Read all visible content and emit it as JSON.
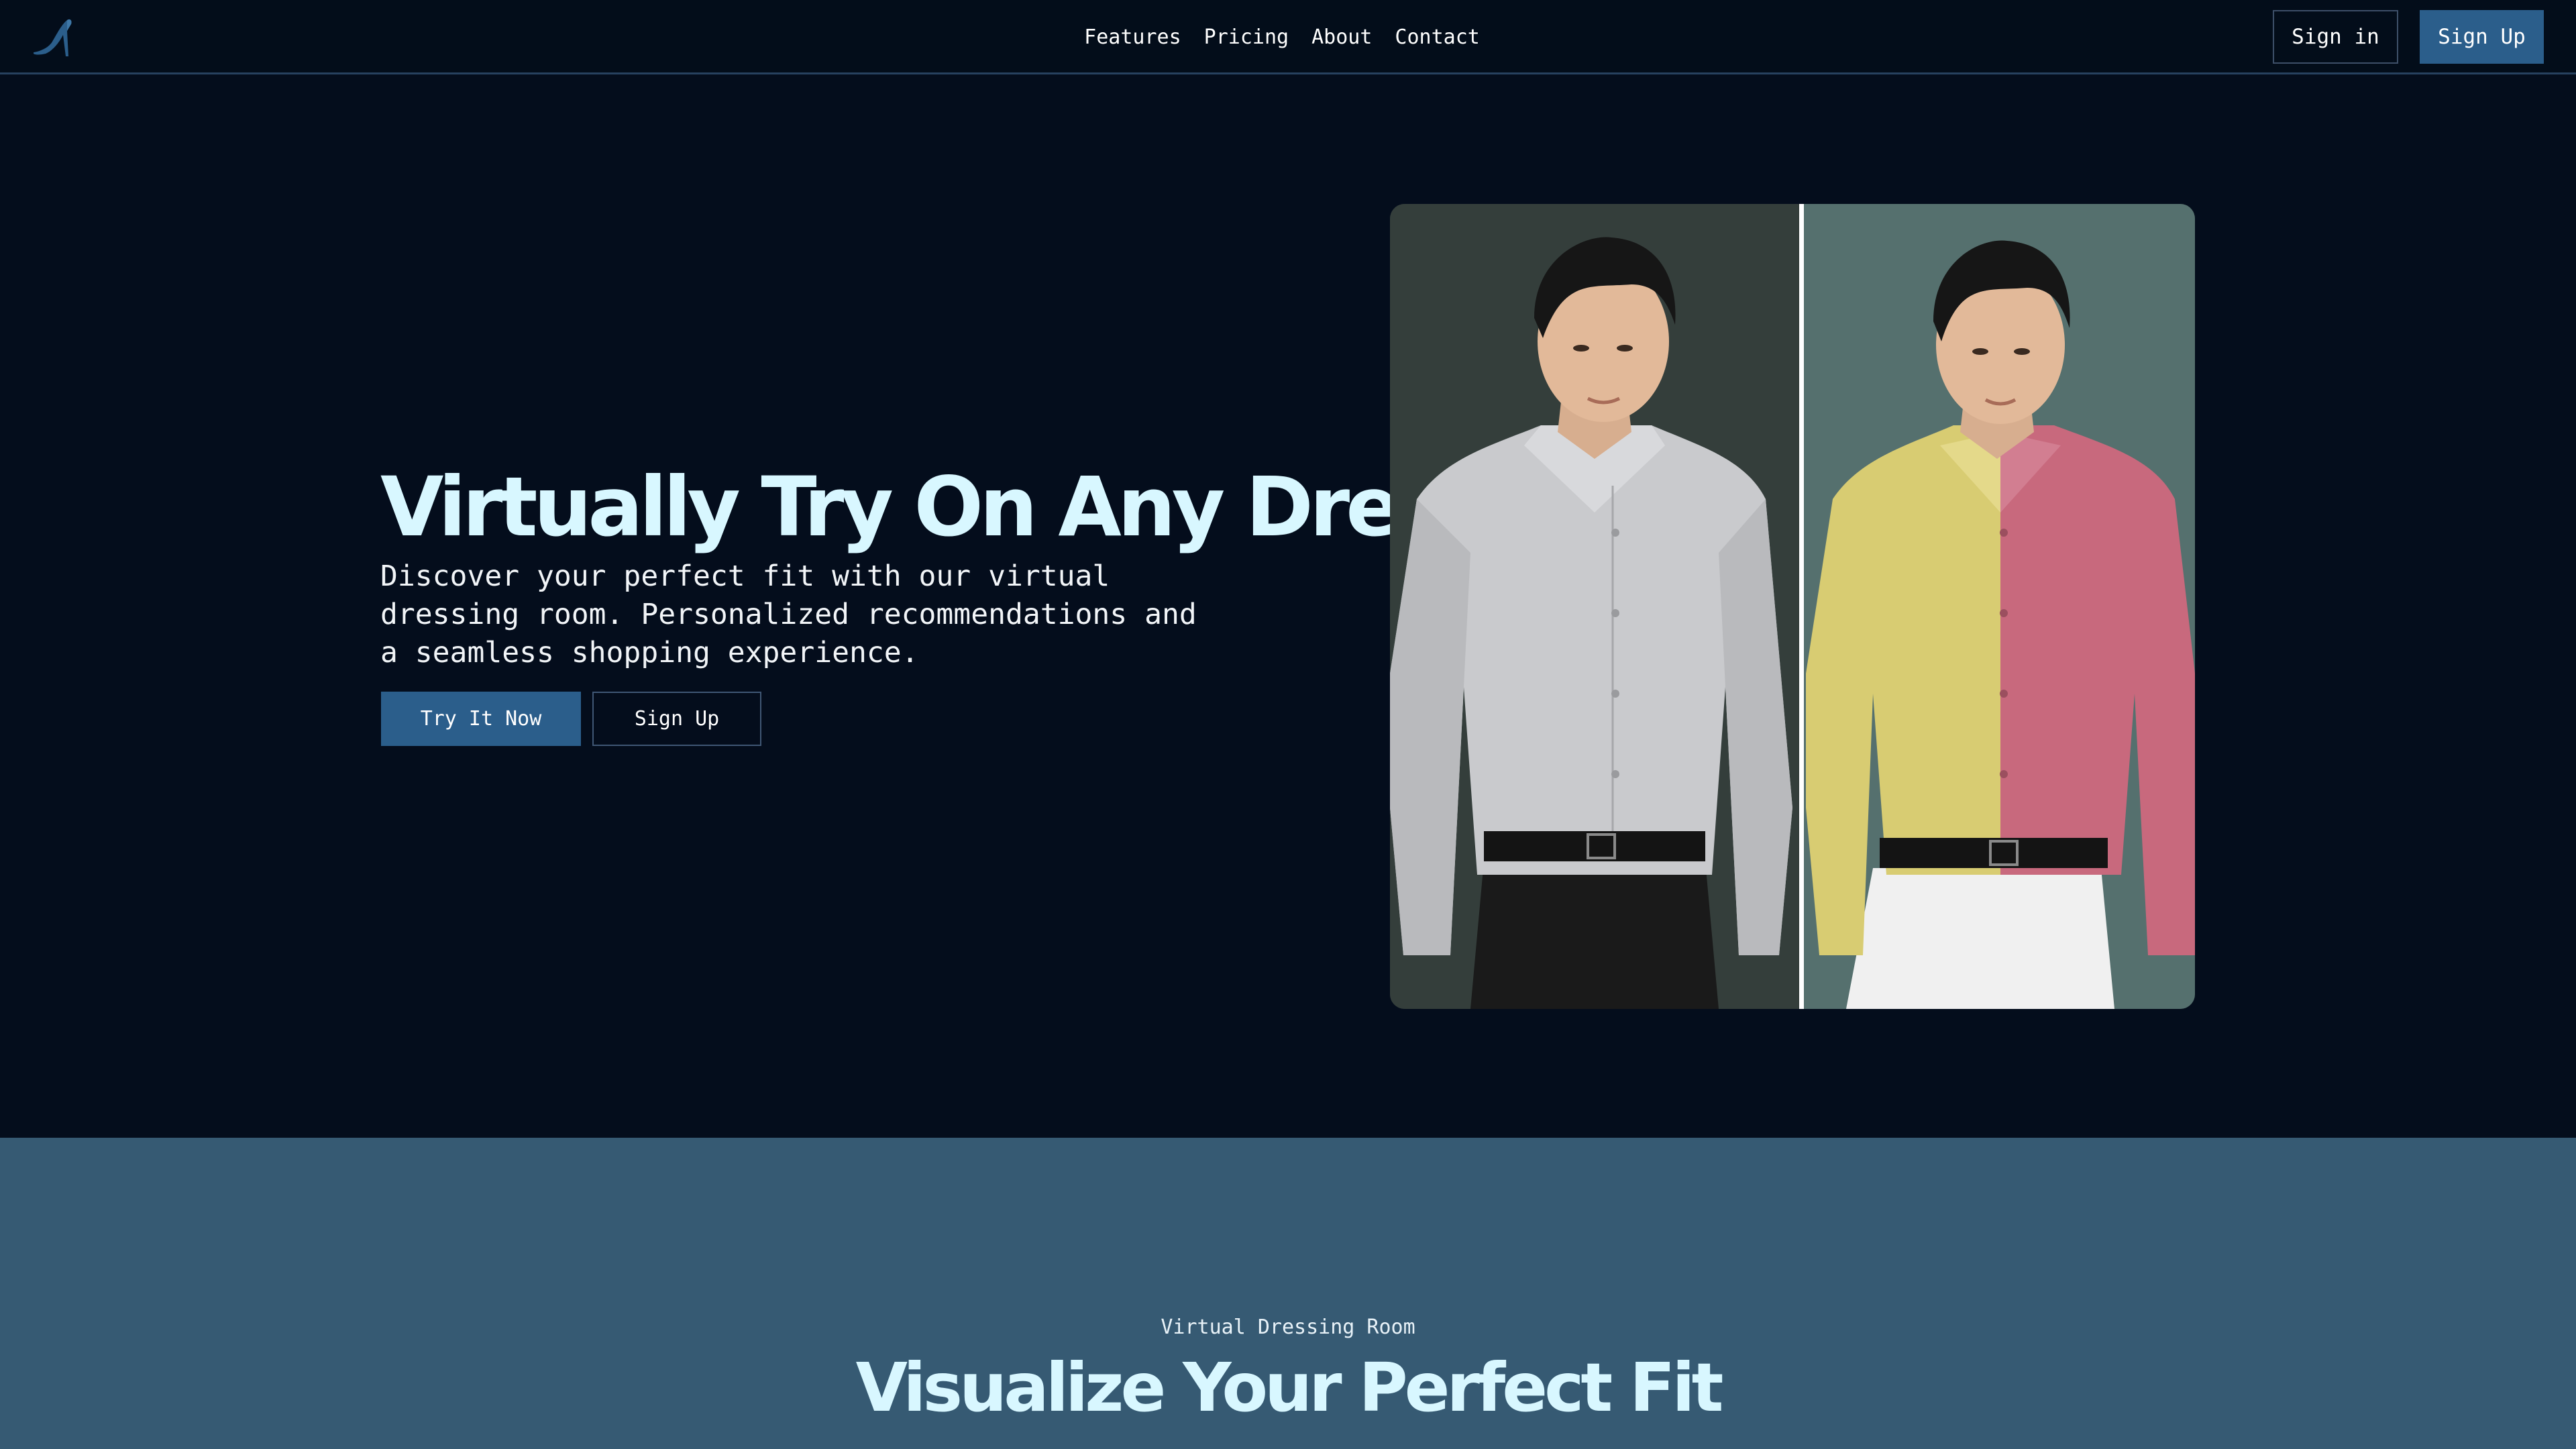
{
  "header": {
    "logo_icon": "high-heel-shoe-icon",
    "nav": [
      "Features",
      "Pricing",
      "About",
      "Contact"
    ],
    "sign_in": "Sign in",
    "sign_up": "Sign Up"
  },
  "hero": {
    "title": "Virtually Try On Any Dress",
    "description": "Discover your perfect fit with our virtual dressing room. Personalized recommendations and a seamless shopping experience.",
    "primary_cta": "Try It Now",
    "secondary_cta": "Sign Up",
    "image_icon": "before-after-shirt-comparison"
  },
  "section": {
    "eyebrow": "Virtual Dressing Room",
    "title": "Visualize Your Perfect Fit",
    "subtitle": ""
  },
  "colors": {
    "background": "#040d1c",
    "accent": "#2b5e8b",
    "heading": "#d8f7ff",
    "section_bg": "#365a73"
  }
}
